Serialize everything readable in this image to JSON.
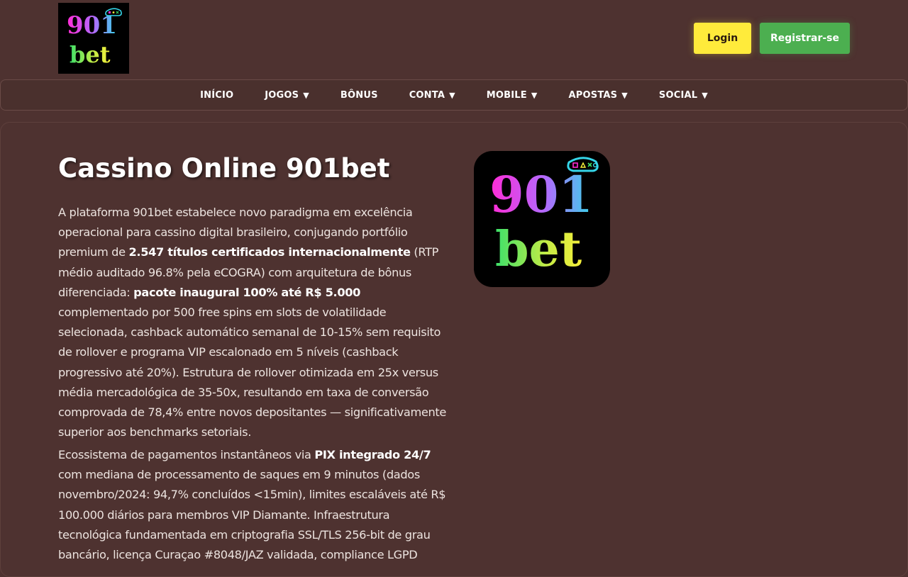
{
  "header": {
    "logo_alt": "901bet",
    "logo_line1": "901",
    "logo_line2": "bet",
    "login_label": "Login",
    "register_label": "Registrar-se"
  },
  "nav": {
    "items": [
      {
        "label": "INÍCIO",
        "caret": ""
      },
      {
        "label": "JOGOS",
        "caret": "▼"
      },
      {
        "label": "BÔNUS",
        "caret": ""
      },
      {
        "label": "CONTA",
        "caret": "▼"
      },
      {
        "label": "MOBILE",
        "caret": "▼"
      },
      {
        "label": "APOSTAS",
        "caret": "▼"
      },
      {
        "label": "SOCIAL",
        "caret": "▼"
      }
    ]
  },
  "main": {
    "title": "Cassino Online 901bet",
    "p1": [
      "A plataforma 901bet estabelece novo paradigma em excelência operacional para cassino digital brasileiro, conjugando portfólio premium de ",
      "2.547 títulos certificados internacionalmente",
      " (RTP médio auditado 96.8% pela eCOGRA) com arquitetura de bônus diferenciada: ",
      "pacote inaugural 100% até R$ 5.000",
      " complementado por 500 free spins em slots de volatilidade selecionada, cashback automático semanal de 10-15% sem requisito de rollover e programa VIP escalonado em 5 níveis (cashback progressivo até 20%). Estrutura de rollover otimizada em 25x versus média mercadológica de 35-50x, resultando em taxa de conversão comprovada de 78,4% entre novos depositantes — significativamente superior aos benchmarks setoriais."
    ],
    "p2": [
      "Ecossistema de pagamentos instantâneos via ",
      "PIX integrado 24/7",
      " com mediana de processamento de saques em 9 minutos (dados novembro/2024: 94,7% concluídos <15min), limites escaláveis até R$ 100.000 diários para membros VIP Diamante. Infraestrutura tecnológica fundamentada em criptografia SSL/TLS 256-bit de grau bancário, licença Curaçao #8048/JAZ validada, compliance LGPD"
    ]
  },
  "colors": {
    "background": "#4e3230",
    "login": "#ffeb3b",
    "register": "#4caf50",
    "logo_magenta": "#ff2bd6",
    "logo_yellow": "#f5ef3a",
    "logo_green": "#3de06a",
    "logo_cyan": "#35d5e8"
  }
}
